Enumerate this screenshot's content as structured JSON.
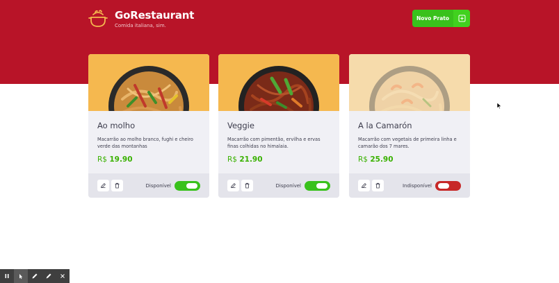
{
  "header": {
    "brand_title": "GoRestaurant",
    "brand_subtitle": "Comida italiana, sim.",
    "new_button_label": "Novo Prato",
    "colors": {
      "background": "#b81428",
      "button": "#39c11c"
    }
  },
  "foods": [
    {
      "name": "Ao molho",
      "description": "Macarrão ao molho branco, fughi e cheiro verde das montanhas",
      "currency": "R$",
      "price": "19.90",
      "availability_label": "Disponível",
      "available": true
    },
    {
      "name": "Veggie",
      "description": "Macarrão com pimentão, ervilha e ervas finas colhidas no himalaia.",
      "currency": "R$",
      "price": "21.90",
      "availability_label": "Disponível",
      "available": true
    },
    {
      "name": "A la Camarón",
      "description": "Macarrão com vegetais de primeira linha e camarão dos 7 mares.",
      "currency": "R$",
      "price": "25.90",
      "availability_label": "Indisponível",
      "available": false
    }
  ],
  "icons": {
    "brand": "chef-pot-icon",
    "new": "plus-square-icon",
    "edit": "edit-icon",
    "delete": "trash-icon",
    "toolbar": [
      "pause-icon",
      "cursor-icon",
      "pen-icon",
      "highlighter-icon",
      "close-icon"
    ]
  },
  "colors": {
    "available_toggle": "#39c11c",
    "unavailable_toggle": "#c72828",
    "price": "#39b100"
  }
}
